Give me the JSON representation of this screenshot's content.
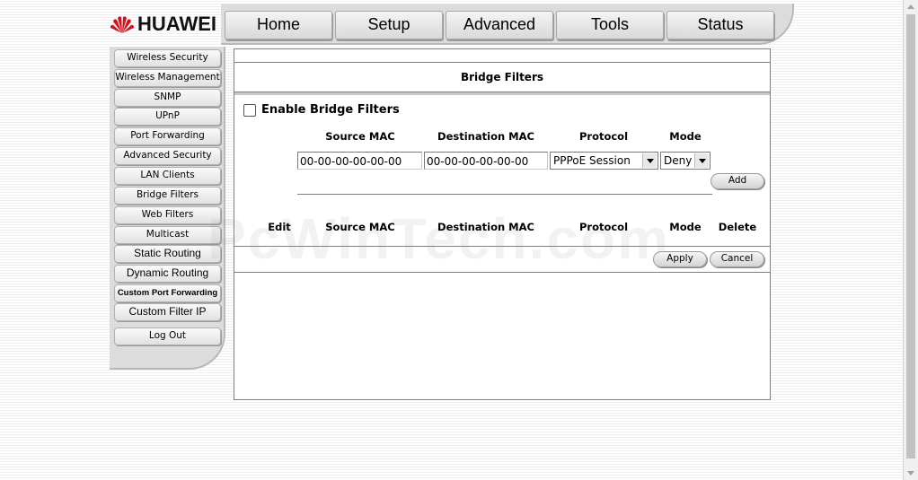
{
  "brand": {
    "name": "HUAWEI"
  },
  "topnav": {
    "tabs": [
      "Home",
      "Setup",
      "Advanced",
      "Tools",
      "Status"
    ]
  },
  "sidebar": {
    "items": [
      "Wireless Security",
      "Wireless Management",
      "SNMP",
      "UPnP",
      "Port Forwarding",
      "Advanced Security",
      "LAN Clients",
      "Bridge Filters",
      "Web Filters",
      "Multicast",
      "Static Routing",
      "Dynamic Routing",
      "Custom Port Forwarding",
      "Custom Filter IP"
    ],
    "logout": "Log Out"
  },
  "panel": {
    "title": "Bridge Filters",
    "enable_label": "Enable Bridge Filters",
    "enable_checked": false,
    "form": {
      "headers": {
        "source_mac": "Source MAC",
        "dest_mac": "Destination MAC",
        "protocol": "Protocol",
        "mode": "Mode"
      },
      "source_mac_value": "00-00-00-00-00-00",
      "dest_mac_value": "00-00-00-00-00-00",
      "protocol_selected": "PPPoE Session",
      "mode_selected": "Deny",
      "add_label": "Add"
    },
    "table": {
      "headers": {
        "edit": "Edit",
        "source_mac": "Source MAC",
        "dest_mac": "Destination MAC",
        "protocol": "Protocol",
        "mode": "Mode",
        "delete": "Delete"
      }
    },
    "apply_label": "Apply",
    "cancel_label": "Cancel"
  },
  "watermark": "PcWinTech.com",
  "colors": {
    "nav_bg": "#dcdcdc",
    "panel_border": "#7f7f7f"
  }
}
